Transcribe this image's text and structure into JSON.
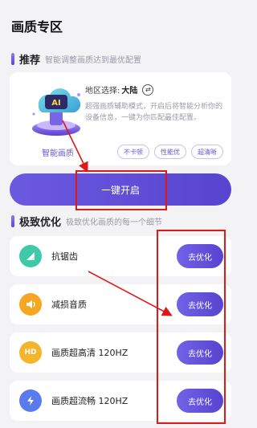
{
  "page": {
    "title": "画质专区"
  },
  "recommend": {
    "title": "推荐",
    "subtitle": "智能调整画质达到最优配置",
    "ai_badge_text": "AI",
    "ai_label": "智能画质",
    "region_label": "地区选择:",
    "region_value": "大陆",
    "description": "超强画质辅助模式，开启后将智能分析你的设备信息，一键为你匹配最佳配置。",
    "tags": [
      "不卡顿",
      "性能优",
      "超清晰"
    ],
    "button_label": "一键开启"
  },
  "optimize": {
    "title": "极致优化",
    "subtitle": "极致优化画质的每一个细节",
    "items": [
      {
        "label": "抗锯齿",
        "icon": "anti-aliasing-icon",
        "icon_color": "#3fc9a8",
        "button_label": "去优化"
      },
      {
        "label": "减损音质",
        "icon": "speaker-icon",
        "icon_color": "#f6a623",
        "button_label": "去优化"
      },
      {
        "label": "画质超高清 120HZ",
        "icon": "hd-icon",
        "icon_badge": "HD",
        "icon_color": "#f5b52a",
        "button_label": "去优化"
      },
      {
        "label": "画质超流畅 120HZ",
        "icon": "lightning-icon",
        "icon_color": "#5a7bf0",
        "button_label": "去优化"
      }
    ]
  },
  "colors": {
    "accent": "#5b47d6",
    "annotation": "#e01818"
  }
}
